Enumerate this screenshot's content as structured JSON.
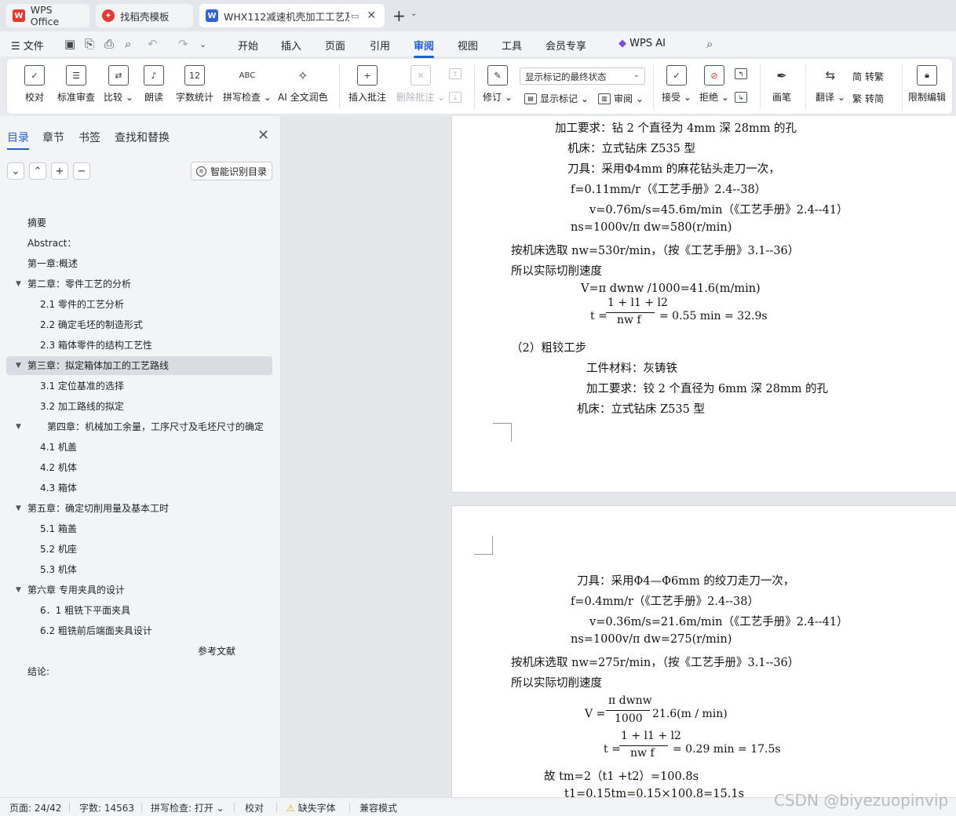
{
  "tabs": {
    "wps": "WPS Office",
    "daoke": "找稻壳模板",
    "doc": "WHX112减速机壳加工工艺及"
  },
  "menu": {
    "file": "文件",
    "items": [
      "开始",
      "插入",
      "页面",
      "引用",
      "审阅",
      "视图",
      "工具",
      "会员专享",
      "WPS AI"
    ],
    "active": "审阅"
  },
  "ribbon": {
    "proofread": "校对",
    "std_review": "标准审查",
    "compare": "比较",
    "read_aloud": "朗读",
    "word_count": "字数统计",
    "spell_check": "拼写检查",
    "ai_polish": "AI 全文润色",
    "insert_comment": "插入批注",
    "delete_comment": "删除批注",
    "revise": "修订",
    "markup_dropdown": "显示标记的最终状态",
    "show_markup": "显示标记",
    "review": "审阅",
    "accept": "接受",
    "reject": "拒绝",
    "pen": "画笔",
    "translate": "翻译",
    "to_traditional": "转繁",
    "to_simplified": "转简",
    "restrict_edit": "限制编辑"
  },
  "nav": {
    "tabs": [
      "目录",
      "章节",
      "书签",
      "查找和替换"
    ],
    "active_tab": "目录",
    "smart_toc": "智能识别目录",
    "toc": [
      {
        "label": "摘要",
        "level": 0,
        "caret": false
      },
      {
        "label": "Abstract：",
        "level": 0,
        "caret": false
      },
      {
        "label": "第一章:概述",
        "level": 0,
        "caret": false
      },
      {
        "label": "第二章：零件工艺的分析",
        "level": 0,
        "caret": true
      },
      {
        "label": "2.1    零件的工艺分析",
        "level": 1,
        "caret": false
      },
      {
        "label": "2.2  确定毛坯的制造形式",
        "level": 1,
        "caret": false
      },
      {
        "label": "2.3 箱体零件的结构工艺性",
        "level": 1,
        "caret": false
      },
      {
        "label": "第三章：拟定箱体加工的工艺路线",
        "level": 0,
        "caret": true,
        "selected": true
      },
      {
        "label": "3.1    定位基准的选择",
        "level": 1,
        "caret": false
      },
      {
        "label": "3.2 加工路线的拟定",
        "level": 1,
        "caret": false
      },
      {
        "label": "第四章：机械加工余量，工序尺寸及毛坯尺寸的确定",
        "level": 0,
        "caret": true,
        "indent_extra": true
      },
      {
        "label": "4.1    机盖",
        "level": 1,
        "caret": false
      },
      {
        "label": "4.2    机体",
        "level": 1,
        "caret": false
      },
      {
        "label": "4.3    箱体",
        "level": 1,
        "caret": false
      },
      {
        "label": "第五章：确定切削用量及基本工时",
        "level": 0,
        "caret": true
      },
      {
        "label": "5.1  箱盖",
        "level": 1,
        "caret": false
      },
      {
        "label": "5.2    机座",
        "level": 1,
        "caret": false
      },
      {
        "label": "5.3  机体",
        "level": 1,
        "caret": false
      },
      {
        "label": "第六章  专用夹具的设计",
        "level": 0,
        "caret": true
      },
      {
        "label": "6．1  粗铣下平面夹具",
        "level": 1,
        "caret": false
      },
      {
        "label": "6.2  粗铣前后端面夹具设计",
        "level": 1,
        "caret": false
      },
      {
        "label": "参考文献",
        "level": 2,
        "caret": false
      },
      {
        "label": "结论:",
        "level": 0,
        "caret": false
      }
    ]
  },
  "page1": {
    "l1": "加工要求：钻 2 个直径为 4mm 深 28mm 的孔",
    "l2": "机床：立式钻床 Z535 型",
    "l3": "刀具：采用Φ4mm 的麻花钻头走刀一次，",
    "l4": "f=0.11mm/r（《工艺手册》2.4--38）",
    "l5": "v=0.76m/s=45.6m/min（《工艺手册》2.4--41）",
    "l6": "ns=1000v/π dw=580(r/min)",
    "l7": "按机床选取 nw=530r/min，（按《工艺手册》3.1--36）",
    "l8": "所以实际切削速度",
    "l9": "V=π dwnw /1000=41.6(m/min)",
    "t_prefix": "t =",
    "t_num": "1 + l1 + l2",
    "t_den": "nw f",
    "t_suffix": "= 0.55 min  = 32.9s",
    "l10": "（2）粗铰工步",
    "l11": "工件材料：灰铸铁",
    "l12": "加工要求：铰 2 个直径为 6mm 深 28mm 的孔",
    "l13": "机床：立式钻床 Z535 型"
  },
  "page2": {
    "l1": "刀具：采用Φ4—Φ6mm 的绞刀走刀一次，",
    "l2": "f=0.4mm/r（《工艺手册》2.4--38）",
    "l3": "v=0.36m/s=21.6m/min（《工艺手册》2.4--41）",
    "l4": "ns=1000v/π dw=275(r/min)",
    "l5": "按机床选取 nw=275r/min，（按《工艺手册》3.1--36）",
    "l6": "所以实际切削速度",
    "v_prefix": "V =",
    "v_num": "π dwnw",
    "v_den": "1000",
    "v_suffix": "21.6(m / min)",
    "t_prefix": "t =",
    "t_num": "1 + l1 + l2",
    "t_den": "nw f",
    "t_suffix": "= 0.29 min  = 17.5s",
    "l7": "故 tm=2（t1 +t2）=100.8s",
    "l8": "t1=0.15tm=0.15×100.8=15.1s"
  },
  "status": {
    "page": "页面: 24/42",
    "words": "字数: 14563",
    "spell": "拼写检查: 打开",
    "proof": "校对",
    "missing_font": "缺失字体",
    "compat": "兼容模式"
  },
  "watermark": "CSDN @biyezuopinvip",
  "colors": {
    "accent": "#1f5fd6",
    "wps_red": "#e8382f",
    "doc_blue": "#2f64d8"
  }
}
